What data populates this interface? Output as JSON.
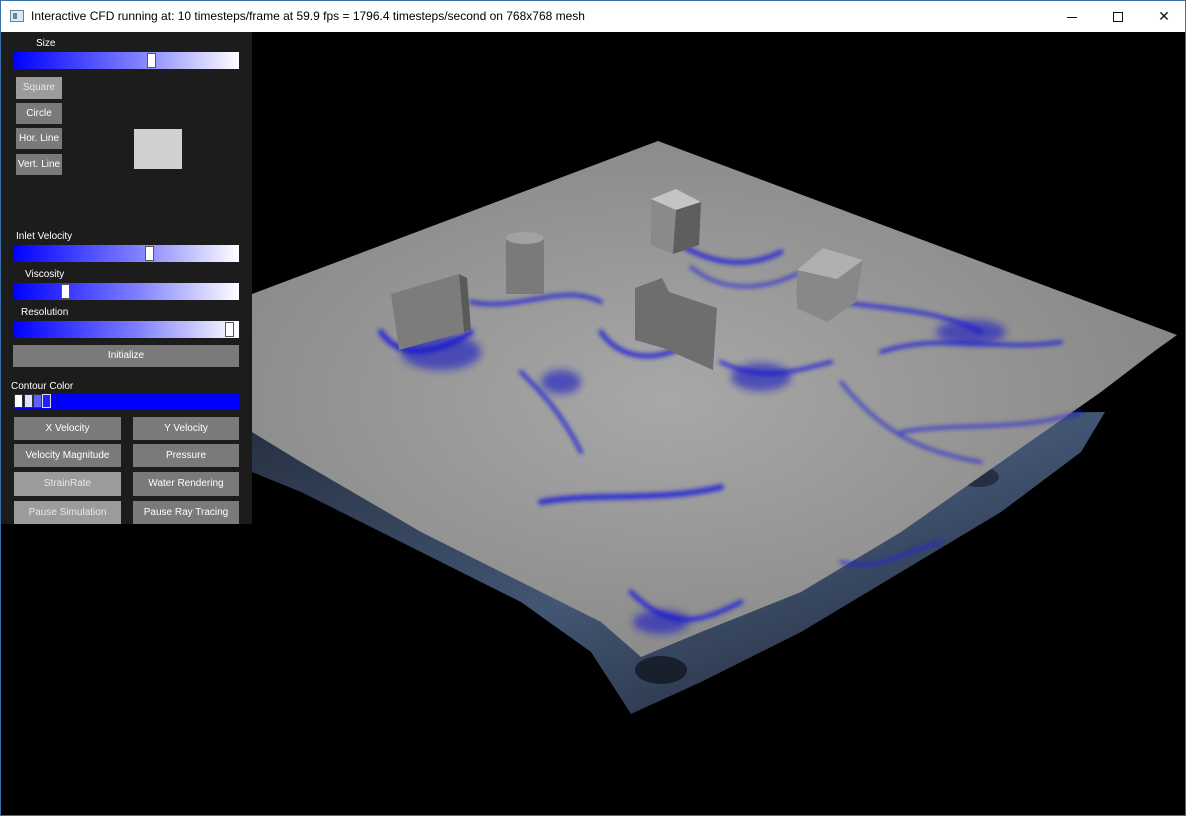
{
  "window": {
    "title": "Interactive CFD running at: 10 timesteps/frame at 59.9 fps = 1796.4 timesteps/second on 768x768 mesh",
    "minimize_glyph": "",
    "maximize_glyph": "",
    "close_glyph": "✕"
  },
  "panel": {
    "size_label": "Size",
    "size_value": 0.62,
    "shape_buttons": [
      "Square",
      "Circle",
      "Hor. Line",
      "Vert. Line"
    ],
    "inlet_velocity_label": "Inlet Velocity",
    "inlet_velocity_value": 0.61,
    "viscosity_label": "Viscosity",
    "viscosity_value": 0.22,
    "resolution_label": "Resolution",
    "resolution_value": 0.98,
    "initialize_label": "Initialize",
    "contour_color_label": "Contour Color",
    "render_buttons": [
      "X Velocity",
      "Y Velocity",
      "Velocity Magnitude",
      "Pressure",
      "StrainRate",
      "Water Rendering"
    ],
    "pause_simulation_label": "Pause Simulation",
    "pause_ray_tracing_label": "Pause Ray Tracing"
  },
  "colors": {
    "slider_start": "#0000ff",
    "slider_end": "#ffffff",
    "contour_accent": "#0000ff",
    "surface": "#9a9a9a",
    "water": "#3a4a62"
  },
  "icons": [
    "app-icon",
    "minimize-icon",
    "maximize-icon",
    "close-icon"
  ]
}
